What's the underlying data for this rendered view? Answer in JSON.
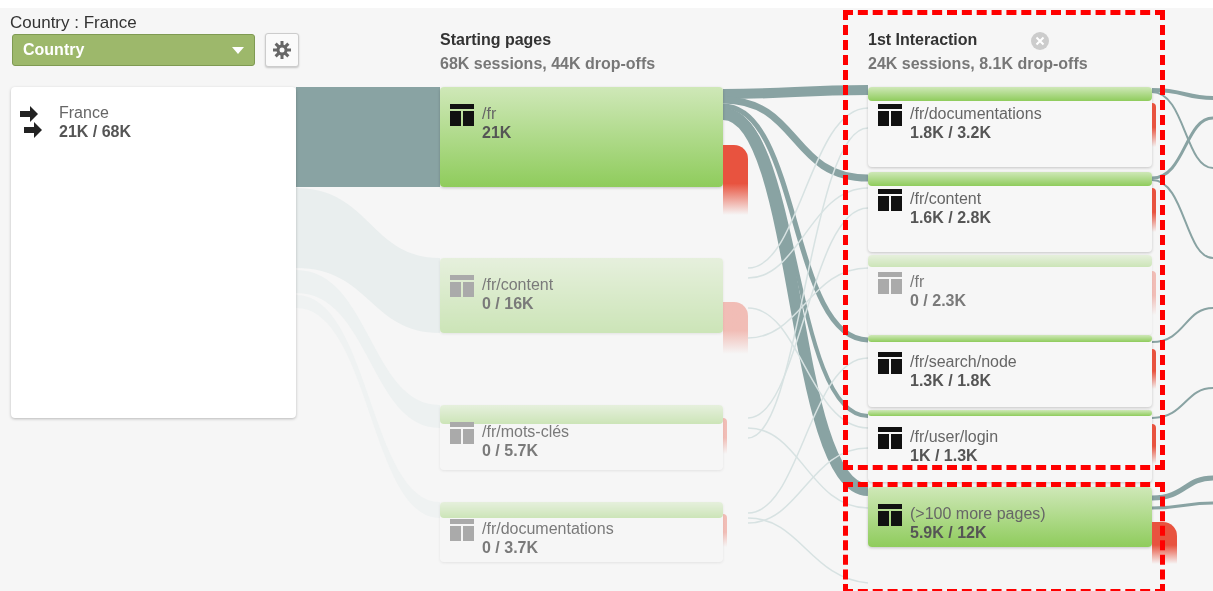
{
  "dimension": {
    "label": "Country : France",
    "dropdown": "Country"
  },
  "root": {
    "label": "France",
    "value": "21K / 68K"
  },
  "columns": [
    {
      "title": "Starting pages",
      "summary": "68K sessions, 44K drop-offs",
      "nodes": [
        {
          "label": "/fr",
          "value": "21K",
          "dimmed": false
        },
        {
          "label": "/fr/content",
          "value": "0 / 16K",
          "dimmed": true
        },
        {
          "label": "/fr/mots-clés",
          "value": "0 / 5.7K",
          "dimmed": true
        },
        {
          "label": "/fr/documentations",
          "value": "0 / 3.7K",
          "dimmed": true
        }
      ]
    },
    {
      "title": "1st Interaction",
      "summary": "24K sessions, 8.1K drop-offs",
      "closable": true,
      "nodes": [
        {
          "label": "/fr/documentations",
          "value": "1.8K / 3.2K",
          "dimmed": false
        },
        {
          "label": "/fr/content",
          "value": "1.6K / 2.8K",
          "dimmed": false
        },
        {
          "label": "/fr",
          "value": "0 / 2.3K",
          "dimmed": true
        },
        {
          "label": "/fr/search/node",
          "value": "1.3K / 1.8K",
          "dimmed": false
        },
        {
          "label": "/fr/user/login",
          "value": "1K / 1.3K",
          "dimmed": false
        },
        {
          "label": "(>100 more pages)",
          "value": "5.9K / 12K",
          "dimmed": false
        }
      ]
    }
  ]
}
